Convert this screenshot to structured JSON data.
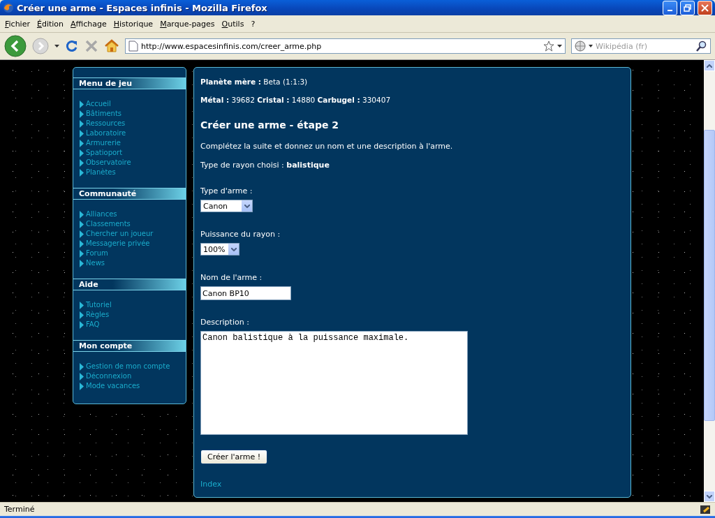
{
  "window": {
    "title": "Créer une arme - Espaces infinis - Mozilla Firefox"
  },
  "menu": [
    "Fichier",
    "Édition",
    "Affichage",
    "Historique",
    "Marque-pages",
    "Outils",
    "?"
  ],
  "toolbar": {
    "url": "http://www.espacesinfinis.com/creer_arme.php",
    "search_placeholder": "Wikipédia (fr)"
  },
  "sidebar": {
    "sections": [
      {
        "title": "Menu de jeu",
        "links": [
          "Accueil",
          "Bâtiments",
          "Ressources",
          "Laboratoire",
          "Armurerie",
          "Spatioport",
          "Observatoire",
          "Planètes"
        ]
      },
      {
        "title": "Communauté",
        "links": [
          "Alliances",
          "Classements",
          "Chercher un joueur",
          "Messagerie privée",
          "Forum",
          "News"
        ]
      },
      {
        "title": "Aide",
        "links": [
          "Tutoriel",
          "Règles",
          "FAQ"
        ]
      },
      {
        "title": "Mon compte",
        "links": [
          "Gestion de mon compte",
          "Déconnexion",
          "Mode vacances"
        ]
      }
    ]
  },
  "page": {
    "info": [
      "**Planète mère :** Beta (1:1:3)",
      "**Métal :** 39682 **Cristal :** 14880 **Carbugel :** 330407"
    ],
    "heading": "Créer une arme - étape 2",
    "intro": "Complétez la suite et donnez un nom et une description à l'arme.",
    "ray_type": "Type de rayon choisi : **balistique**",
    "fields": [
      {
        "kind": "select",
        "label": "Type d'arme :",
        "value": "Canon"
      },
      {
        "kind": "select",
        "label": "Puissance du rayon :",
        "value": "100%"
      },
      {
        "kind": "text",
        "label": "Nom de l'arme :",
        "value": "Canon BP10"
      },
      {
        "kind": "textarea",
        "label": "Description :",
        "value": "Canon balistique à la puissance maximale."
      }
    ],
    "submit": "Créer l'arme !",
    "footer_link": "Index"
  },
  "status_bar": {
    "text": "Terminé"
  }
}
